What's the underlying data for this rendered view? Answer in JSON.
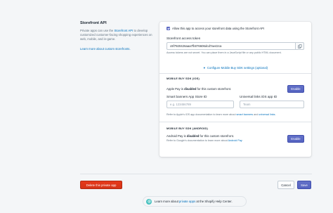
{
  "intro": {
    "title": "Storefront API",
    "desc_pre": "Private apps can use the ",
    "desc_link": "Storefront API",
    "desc_post": " to develop customized customer-facing shopping experiences on web, mobile, and in-game.",
    "learn_link": "Learn more about custom storefronts."
  },
  "card": {
    "allow_label": "Allow this app to access your storefront data using the Storefront API",
    "token_label": "Storefront access token",
    "token_value": "c6f7920426aaa7fb076606dcd7ae42ca",
    "token_note": "Access tokens are not secret. You can place them in a JavaScript file or any public HTML document.",
    "sdk_link": "Configure Mobile Buy SDK settings (optional)",
    "ios": {
      "heading": "MOBILE BUY SDK (IOS)",
      "apple_pay_pre": "Apple Pay is ",
      "apple_pay_status": "disabled",
      "apple_pay_post": " for this custom storefront.",
      "enable_label": "Enable",
      "smart_banners_label": "Smart banners App Store ID",
      "smart_banners_placeholder": "e.g. 123456789",
      "universal_links_label": "Universal links iOS app ID",
      "universal_links_placeholder": "Team",
      "note_pre": "Refer to Apple's iOS app documentation to learn more about ",
      "note_link1": "smart banners",
      "note_mid": " and ",
      "note_link2": "universal links",
      "note_post": "."
    },
    "android": {
      "heading": "MOBILE BUY SDK (ANDROID)",
      "pay_pre": "Android Pay is ",
      "pay_status": "disabled",
      "pay_post": " for this custom storefront.",
      "note_pre": "Refer to Google's documentation to learn more about ",
      "note_link": "Android Pay",
      "enable_label": "Enable"
    }
  },
  "footer": {
    "delete_label": "Delete this private app",
    "cancel_label": "Cancel",
    "save_label": "Save"
  },
  "help": {
    "pre": "Learn more about ",
    "link": "private apps",
    "post": " at the Shopify Help Center."
  },
  "colors": {
    "accent": "#5c6ac4",
    "link": "#006fbb",
    "danger": "#de3618",
    "background": "#f4f6f8"
  }
}
